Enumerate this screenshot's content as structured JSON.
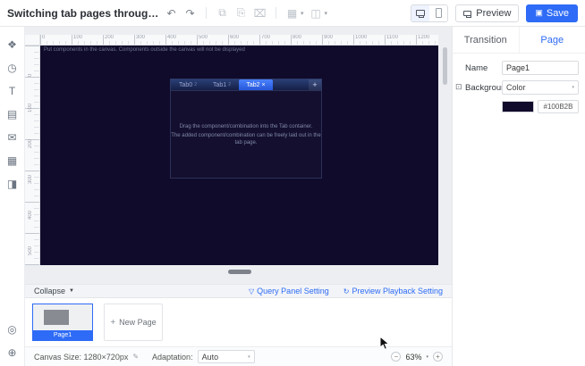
{
  "titlebar": {
    "title": "Switching tab pages through FVS wid...",
    "icons": {
      "undo": "↶",
      "redo": "↷",
      "copy": "⧉",
      "paste": "⎘",
      "delete": "⌧",
      "group": "▦",
      "layers": "◫",
      "caret": "▾",
      "save": "▣"
    },
    "preview_label": "Preview",
    "save_label": "Save"
  },
  "sidebar": {
    "icons": {
      "widgets": "❖",
      "time": "◷",
      "text": "T",
      "chart": "▤",
      "mail": "✉",
      "table": "▦",
      "shape": "◨",
      "support": "◎",
      "globe": "⊕"
    }
  },
  "canvas": {
    "notice": "Put components in the canvas. Components outside the canvas will not be displayed",
    "ruler_top": [
      "0",
      "100",
      "200",
      "300",
      "400",
      "500",
      "600",
      "700",
      "800",
      "900",
      "1000",
      "1100",
      "1200"
    ],
    "ruler_left": [
      "0",
      "100",
      "200",
      "300",
      "400",
      "500",
      "600",
      "700"
    ],
    "widget": {
      "tabs": [
        {
          "label": "Tab0",
          "badge": "2"
        },
        {
          "label": "Tab1",
          "badge": "2"
        },
        {
          "label": "Tab2",
          "badge": "2"
        }
      ],
      "close_glyph": "×",
      "add_glyph": "+",
      "hint_line1": "Drag the component/combination into the Tab container.",
      "hint_line2": "The added component/combination can be freely laid out in the tab page."
    }
  },
  "footer": {
    "collapse_label": "Collapse",
    "collapse_caret": "▼",
    "query_icon": "▽",
    "query_label": "Query Panel Setting",
    "playback_icon": "↻",
    "playback_label": "Preview Playback Setting",
    "page_label": "Page1",
    "new_page_plus": "+",
    "new_page_label": "New Page"
  },
  "statusbar": {
    "canvas_size_label": "Canvas Size: 1280×720px",
    "edit_icon": "✎",
    "adaptation_label": "Adaptation:",
    "adaptation_value": "Auto",
    "zoom_minus": "−",
    "zoom_value": "63%",
    "zoom_caret": "▾",
    "zoom_plus": "+"
  },
  "inspector": {
    "tab_transition": "Transition",
    "tab_page": "Page",
    "name_label": "Name",
    "name_value": "Page1",
    "background_icon": "⊡",
    "background_label": "Background",
    "background_value": "Color",
    "select_caret": "▾",
    "color_hex": "#100B2B"
  },
  "colors": {
    "accent": "#2E6BF6",
    "canvas_bg": "#100B2B"
  }
}
